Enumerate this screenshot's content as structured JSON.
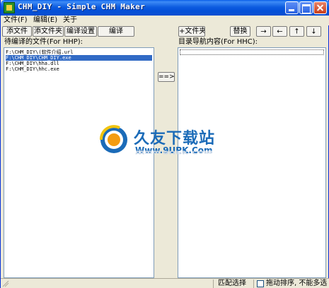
{
  "window": {
    "title": "CHM_DIY - Simple CHM Maker",
    "icon": "app-icon"
  },
  "menubar": {
    "items": [
      "文件(F)",
      "编辑(E)",
      "关于"
    ]
  },
  "toolbar_left": {
    "add_file": "添文件",
    "add_folder": "添文件夹",
    "compile_settings": "编译设置",
    "compile": "编译"
  },
  "toolbar_right": {
    "add_folder": "+文件夹",
    "replace": "替换",
    "arrows": [
      "→",
      "←",
      "↑",
      "↓"
    ]
  },
  "left_panel": {
    "label": "待编译的文件(For HHP):",
    "files": [
      "F:\\CHM_DIY\\(软件介绍.url",
      "F:\\CHM_DIY\\CHM_DIY.exe",
      "F:\\CHM_DIY\\hha.dll",
      "F:\\CHM_DIY\\hhc.exe"
    ],
    "selected_index": 1
  },
  "middle": {
    "transfer": "==>"
  },
  "right_panel": {
    "label": "目录导航内容(For HHC):"
  },
  "watermark": {
    "brand": "久友下载站",
    "url": "Www.9UPK.Com"
  },
  "statusbar": {
    "match_select": "匹配选择",
    "drag_sort": "拖动排序, 不能多选"
  },
  "colors": {
    "titlebar": "#0a5fe8",
    "selection": "#316ac5",
    "watermark": "#1b6bb8"
  }
}
